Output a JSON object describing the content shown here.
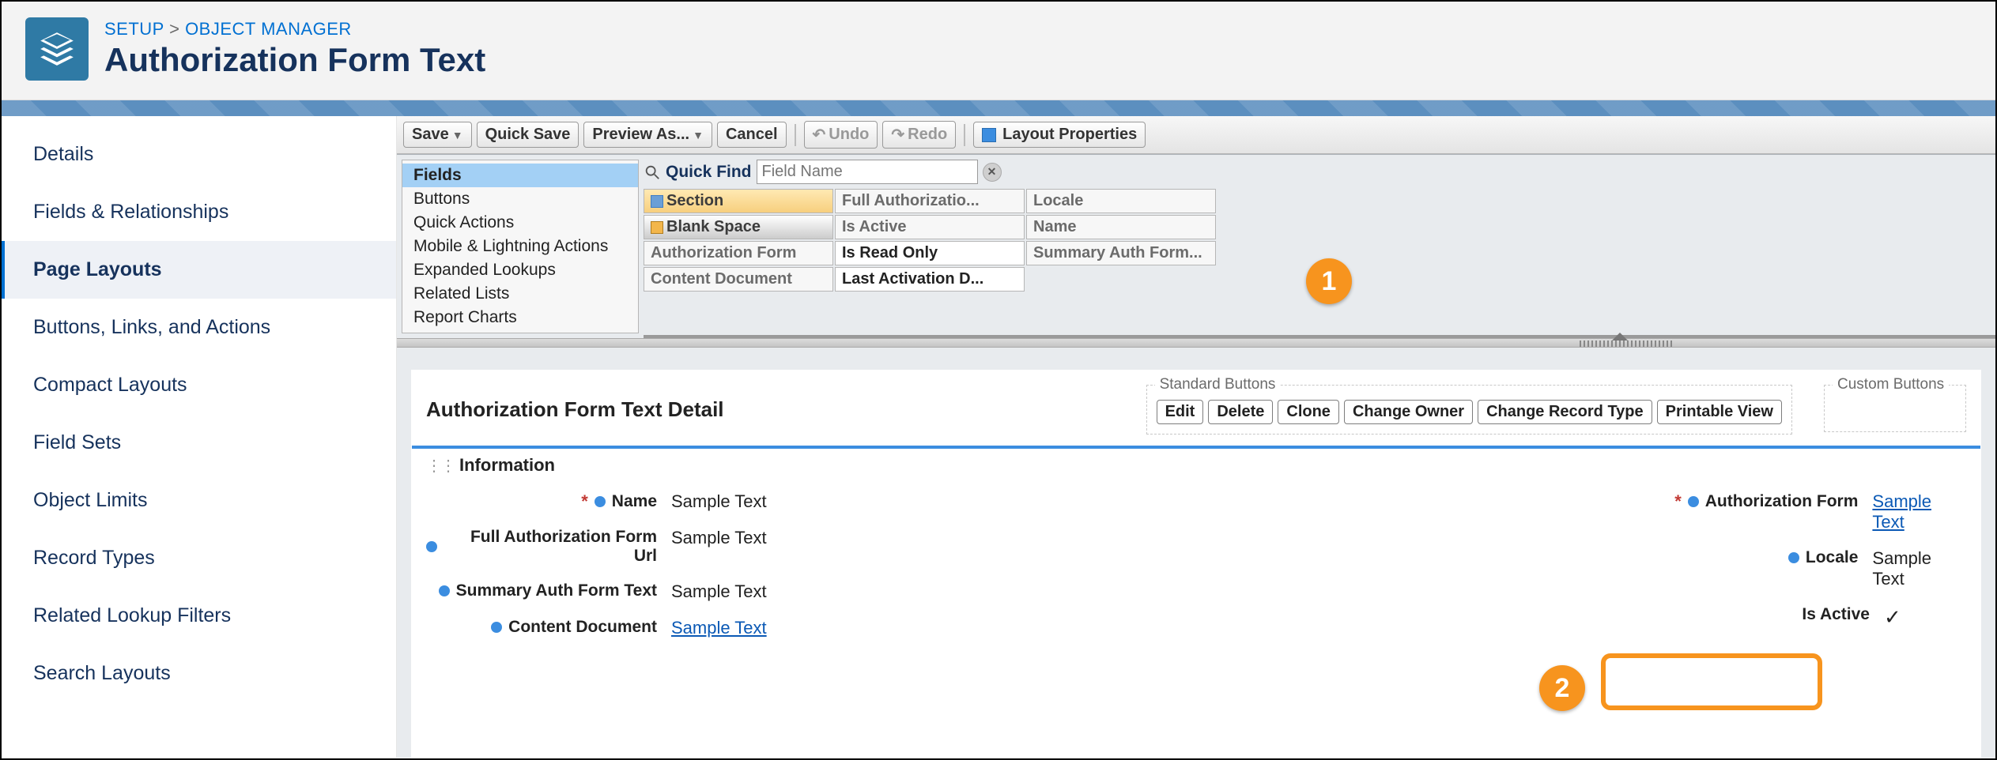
{
  "breadcrumb": {
    "setup": "SETUP",
    "object_manager": "OBJECT MANAGER",
    "sep": ">"
  },
  "page_title": "Authorization Form Text",
  "sidebar": {
    "items": [
      {
        "label": "Details"
      },
      {
        "label": "Fields & Relationships"
      },
      {
        "label": "Page Layouts"
      },
      {
        "label": "Buttons, Links, and Actions"
      },
      {
        "label": "Compact Layouts"
      },
      {
        "label": "Field Sets"
      },
      {
        "label": "Object Limits"
      },
      {
        "label": "Record Types"
      },
      {
        "label": "Related Lookup Filters"
      },
      {
        "label": "Search Layouts"
      }
    ],
    "active_index": 2
  },
  "toolbar": {
    "save": "Save",
    "quick_save": "Quick Save",
    "preview_as": "Preview As...",
    "cancel": "Cancel",
    "undo": "Undo",
    "redo": "Redo",
    "layout_properties": "Layout Properties"
  },
  "palette": {
    "categories": [
      "Fields",
      "Buttons",
      "Quick Actions",
      "Mobile & Lightning Actions",
      "Expanded Lookups",
      "Related Lists",
      "Report Charts"
    ],
    "selected_category_index": 0,
    "quick_find_label": "Quick Find",
    "quick_find_placeholder": "Field Name",
    "grid": [
      [
        "Section",
        "Full Authorizatio...",
        "Locale"
      ],
      [
        "Blank Space",
        "Is Active",
        "Name"
      ],
      [
        "Authorization Form",
        "Is Read Only",
        "Summary Auth Form..."
      ],
      [
        "Content Document",
        "Last Activation D...",
        ""
      ]
    ]
  },
  "detail": {
    "title": "Authorization Form Text Detail",
    "standard_buttons_legend": "Standard Buttons",
    "custom_buttons_legend": "Custom Buttons",
    "standard_buttons": [
      "Edit",
      "Delete",
      "Clone",
      "Change Owner",
      "Change Record Type",
      "Printable View"
    ],
    "section_name": "Information",
    "left_fields": [
      {
        "label": "Name",
        "value": "Sample Text",
        "required": true,
        "link": false
      },
      {
        "label": "Full Authorization Form Url",
        "value": "Sample Text",
        "required": false,
        "link": false
      },
      {
        "label": "Summary Auth Form Text",
        "value": "Sample Text",
        "required": false,
        "link": false
      },
      {
        "label": "Content Document",
        "value": "Sample Text",
        "required": false,
        "link": true
      }
    ],
    "right_fields": [
      {
        "label": "Authorization Form",
        "value": "Sample Text",
        "required": true,
        "link": true
      },
      {
        "label": "Locale",
        "value": "Sample Text",
        "required": false,
        "link": false
      },
      {
        "label": "Is Active",
        "value": "✓",
        "required": false,
        "link": false,
        "nodot": true
      }
    ]
  },
  "callouts": {
    "c1": "1",
    "c2": "2"
  }
}
